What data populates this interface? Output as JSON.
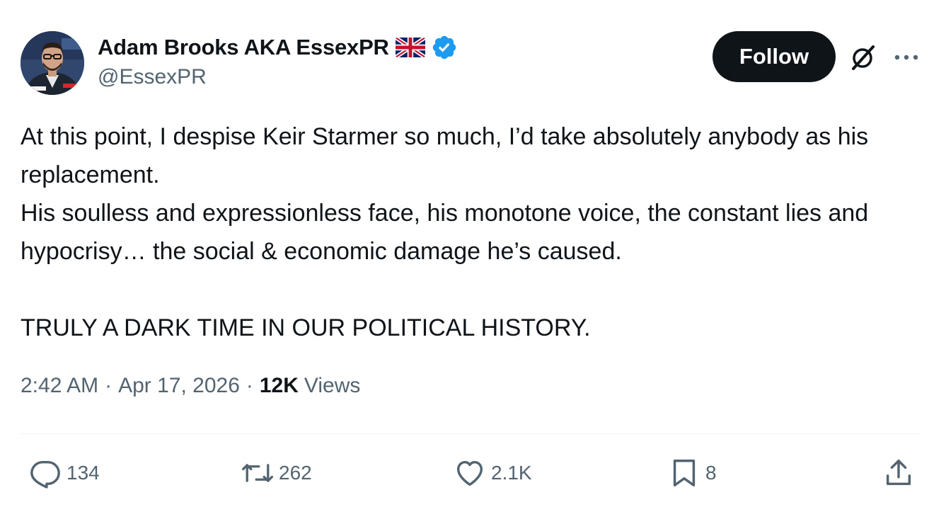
{
  "author": {
    "display_name": "Adam Brooks AKA EssexPR",
    "handle": "@EssexPR",
    "flag_icon": "uk-flag-icon",
    "verified_icon": "verified-badge-icon"
  },
  "header": {
    "follow_label": "Follow",
    "grok_icon": "grok-icon",
    "more_icon": "more-dots-icon"
  },
  "tweet": {
    "lines": [
      "At this point, I despise Keir Starmer so much, I’d take absolutely anybody as his replacement.",
      "His soulless and expressionless face, his monotone voice, the constant lies and hypocrisy… the social & economic damage he’s caused.",
      "",
      "TRULY A DARK TIME IN OUR POLITICAL HISTORY."
    ]
  },
  "meta": {
    "time": "2:42 AM",
    "date": "Apr 17, 2026",
    "views_count": "12K",
    "views_label": "Views",
    "separator": "·"
  },
  "actions": {
    "replies": "134",
    "reposts": "262",
    "likes": "2.1K",
    "bookmarks": "8"
  },
  "colors": {
    "text_primary": "#0f1419",
    "text_secondary": "#536471",
    "verified_blue": "#1d9bf0",
    "follow_bg": "#0f1419",
    "divider": "#eff3f4"
  }
}
